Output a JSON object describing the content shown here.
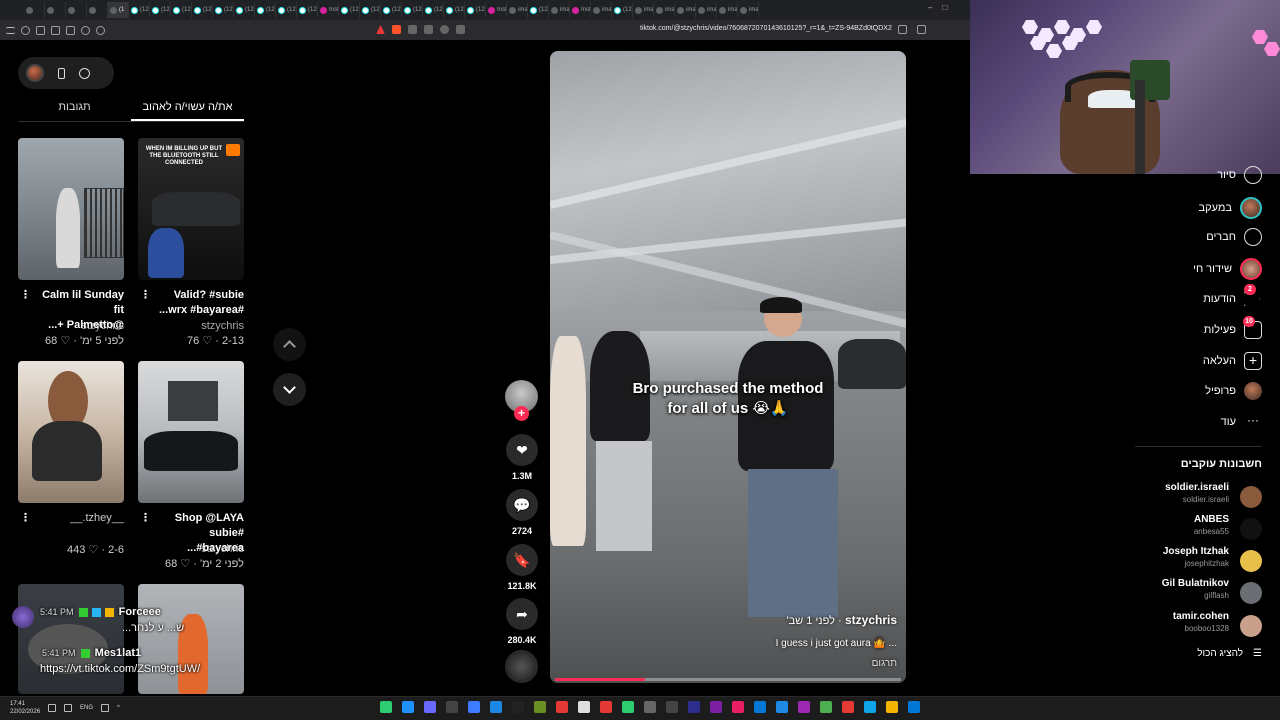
{
  "browser": {
    "tabs": [
      {
        "label": "",
        "kind": "plain"
      },
      {
        "label": "",
        "kind": "plain"
      },
      {
        "label": "",
        "kind": "plain"
      },
      {
        "label": "",
        "kind": "plain"
      },
      {
        "label": "(1",
        "kind": "active"
      },
      {
        "label": "(12)",
        "kind": "tt"
      },
      {
        "label": "(12)",
        "kind": "tt"
      },
      {
        "label": "(12)",
        "kind": "tt"
      },
      {
        "label": "(12)",
        "kind": "tt"
      },
      {
        "label": "(12)",
        "kind": "tt"
      },
      {
        "label": "(12)",
        "kind": "tt"
      },
      {
        "label": "(12)",
        "kind": "tt"
      },
      {
        "label": "(12)",
        "kind": "tt"
      },
      {
        "label": "(12)",
        "kind": "tt"
      },
      {
        "label": "Insta",
        "kind": "ig"
      },
      {
        "label": "(12)",
        "kind": "tt"
      },
      {
        "label": "(12)",
        "kind": "tt"
      },
      {
        "label": "(12)",
        "kind": "tt"
      },
      {
        "label": "(12)",
        "kind": "tt"
      },
      {
        "label": "(12)",
        "kind": "tt"
      },
      {
        "label": "(12)",
        "kind": "tt"
      },
      {
        "label": "(12)",
        "kind": "tt"
      },
      {
        "label": "Insta",
        "kind": "ig"
      },
      {
        "label": "imag",
        "kind": "plain"
      },
      {
        "label": "(12)",
        "kind": "tt"
      },
      {
        "label": "imag",
        "kind": "plain"
      },
      {
        "label": "Insta",
        "kind": "ig"
      },
      {
        "label": "imag",
        "kind": "plain"
      },
      {
        "label": "(12)",
        "kind": "tt"
      },
      {
        "label": "imag",
        "kind": "plain"
      },
      {
        "label": "imag",
        "kind": "plain"
      },
      {
        "label": "imag",
        "kind": "plain"
      },
      {
        "label": "imag",
        "kind": "plain"
      },
      {
        "label": "imag",
        "kind": "plain"
      },
      {
        "label": "imag",
        "kind": "plain"
      }
    ],
    "url": "tiktok.com/@stzychris/video/7606872070143610125?_r=1&_t=ZS-94BZd0tQDX2"
  },
  "tabs": {
    "liked": "את/ה עשוי/ה לאהוב",
    "comments": "תגובות"
  },
  "grid": [
    {
      "caption_line1": "Calm lil Sunday fit",
      "caption_line2": "@Palmetto +...",
      "author": "stzychris",
      "likes": "68",
      "age": "לפני 5 ימ'",
      "thumb": "t1"
    },
    {
      "caption_line1": "Valid? #subie",
      "caption_line2": "#wrx #bayarea...",
      "author": "stzychris",
      "likes": "76",
      "age": "2-13",
      "thumb": "t2",
      "overlay_text": "WHEN IM BILLING UP BUT THE BLUETOOTH STILL CONNECTED"
    },
    {
      "caption_line1": "",
      "caption_line2": "__tzhey.__",
      "author": "",
      "likes": "443",
      "age": "2-6",
      "thumb": "t3"
    },
    {
      "caption_line1": "Shop @LAYA",
      "caption_line2": "#subie #bayarea...",
      "author": "stzychris",
      "likes": "68",
      "age": "לפני 2 ימ'",
      "thumb": "t4"
    },
    {
      "thumb": "t5"
    },
    {
      "thumb": "t6"
    }
  ],
  "chat": {
    "line1_time": "5:41 PM",
    "line1_user": "Forceee",
    "line2_text": "ש... ע לנחר...",
    "line3_time": "5:41 PM",
    "line3_user": "Mes1lat1",
    "line4_text": "https://vt.tiktok.com/ZSm9tgtUW/"
  },
  "video": {
    "overlay_caption_line1": "Bro purchased the method",
    "overlay_caption_line2": "for all of us 😭🙏",
    "author": "stzychris",
    "age": "· לפני 1 שב'",
    "description": "I guess i just got aura 🤷 ...",
    "translate": "תרגום",
    "progress": 0.26
  },
  "actions": {
    "likes": "1.3M",
    "comments": "2724",
    "saves": "121.8K",
    "shares": "280.4K"
  },
  "sidebar": {
    "items": [
      {
        "label": "סיור",
        "icon": "explore-icon"
      },
      {
        "label": "במעקב",
        "icon": "following-avatar-icon"
      },
      {
        "label": "חברים",
        "icon": "friends-icon"
      },
      {
        "label": "שידור חי",
        "icon": "live-icon"
      },
      {
        "label": "הודעות",
        "icon": "messages-icon",
        "badge": "2"
      },
      {
        "label": "פעילות",
        "icon": "activity-icon",
        "badge": "10"
      },
      {
        "label": "העלאה",
        "icon": "upload-icon"
      },
      {
        "label": "פרופיל",
        "icon": "profile-avatar-icon"
      },
      {
        "label": "עוד",
        "icon": "more-icon"
      }
    ],
    "following_header": "חשבונות עוקבים",
    "following": [
      {
        "name": "soldier.israeli",
        "handle": "soldier.israeli",
        "color": "#8a5a3c"
      },
      {
        "name": "ANBES",
        "handle": "anbesa55",
        "color": "#111111"
      },
      {
        "name": "Joseph Itzhak",
        "handle": "josephitzhak",
        "color": "#e6c04a"
      },
      {
        "name": "Gil Bulatnikov",
        "handle": "gilflash",
        "color": "#6b6f73"
      },
      {
        "name": "tamir.cohen",
        "handle": "booboo1328",
        "color": "#c9a089"
      }
    ],
    "show_all": "להציג הכול"
  },
  "taskbar": {
    "time": "17:41",
    "date": "22/02/2026",
    "lang": "ENG",
    "apps": [
      "#2dcc70",
      "#1e90ff",
      "#6a6aff",
      "#444",
      "#3d7bff",
      "#1e88e5",
      "#222",
      "#6b8e23",
      "#e53935",
      "#ddd",
      "#e53935",
      "#2ecc71",
      "#666",
      "#444",
      "#2d2d8f",
      "#7b1fa2",
      "#e91e63",
      "#0078d7",
      "#1e88e5",
      "#9c27b0",
      "#4caf50",
      "#e53935",
      "#0ea5e9",
      "#f4b400",
      "#0078d7"
    ]
  }
}
